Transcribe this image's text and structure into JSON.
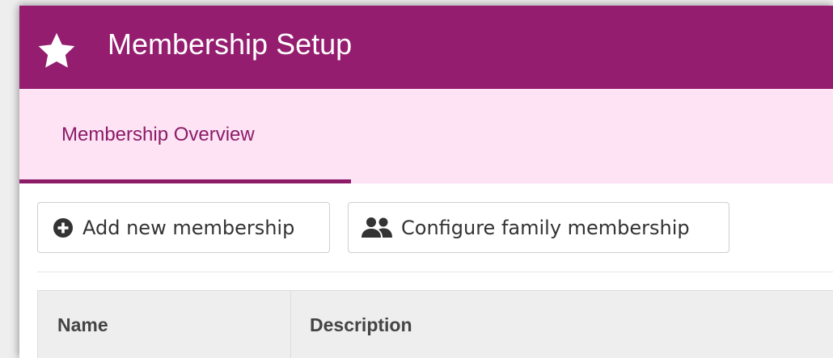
{
  "header": {
    "title": "Membership Setup",
    "icon": "star-icon",
    "background_color": "#951d6f"
  },
  "tabs": [
    {
      "label": "Membership Overview",
      "active": true
    }
  ],
  "toolbar": {
    "add_button": {
      "label": "Add new membership",
      "icon": "plus-circle-icon"
    },
    "family_button": {
      "label": "Configure family membership",
      "icon": "users-icon"
    }
  },
  "table": {
    "columns": [
      "Name",
      "Description"
    ]
  },
  "colors": {
    "brand": "#951d6f",
    "tab_bar_bg": "#fde3f4",
    "tab_active": "#8c1c68"
  }
}
